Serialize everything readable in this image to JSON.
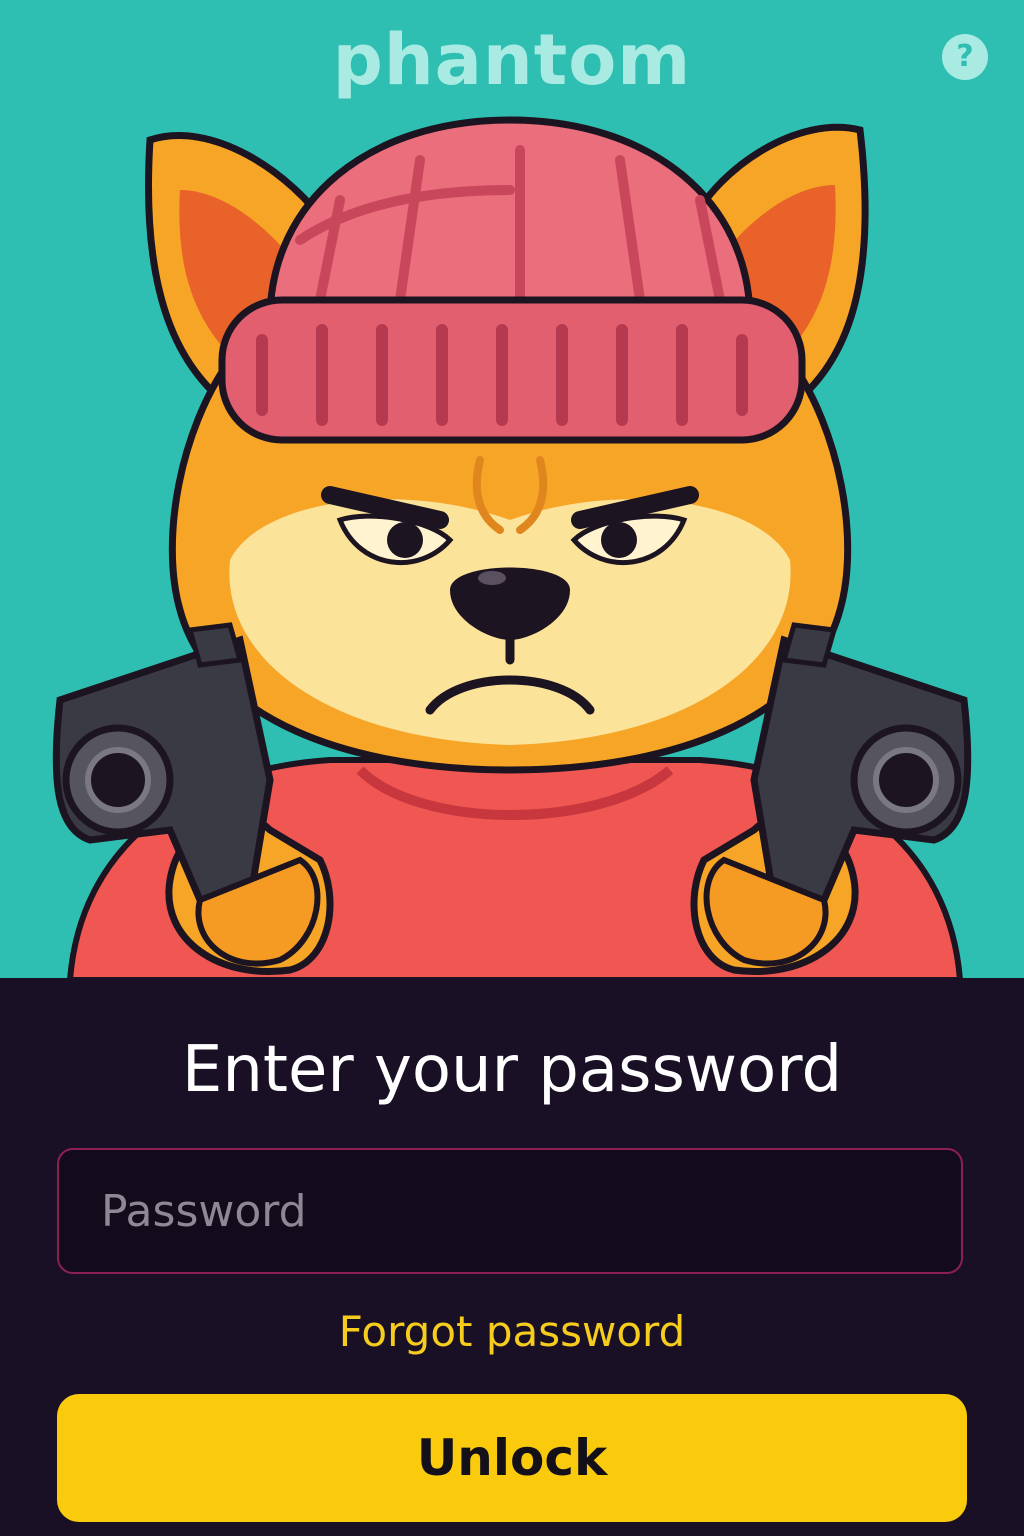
{
  "header": {
    "app_title": "phantom",
    "help_icon": "question-circle-icon",
    "help_glyph": "?"
  },
  "hero": {
    "illustration": "angry-dog-mascot-illustration",
    "colors": {
      "background": "#2fbfb2",
      "fur": "#f7a527",
      "beanie": "#e85e6e",
      "sweater": "#f05752",
      "guns": "#3a3a44"
    }
  },
  "unlock": {
    "heading": "Enter your password",
    "password_field": {
      "value": "",
      "placeholder": "Password"
    },
    "forgot_link": "Forgot password",
    "unlock_label": "Unlock"
  },
  "theme": {
    "panel_background": "#1a1026",
    "accent_yellow": "#f9cb0c",
    "field_border": "#8c1f54"
  }
}
